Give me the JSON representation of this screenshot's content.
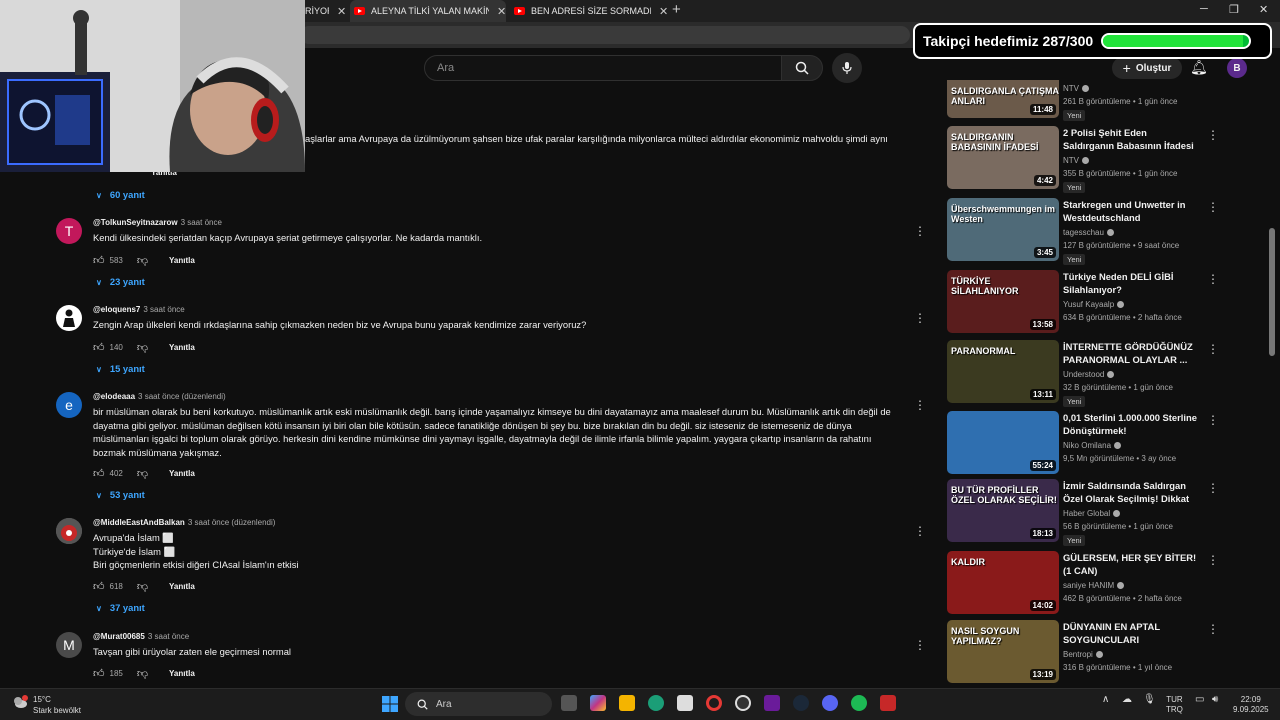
{
  "browser": {
    "tabs": [
      {
        "label": "RİYOR"
      },
      {
        "label": "ALEYNA TİLKİ YALAN MAKİNESİNE GİRDİ"
      },
      {
        "label": "BEN ADRESİ SİZE SORMADIM - A"
      }
    ]
  },
  "overlay": {
    "follower_goal_text": "Takipçi hedefimiz 287/300",
    "follower_progress": 0.957
  },
  "header": {
    "search_placeholder": "Ara",
    "create_label": "Oluştur",
    "avatar_letter": "B"
  },
  "comments": [
    {
      "text_partial": "aşlarlar ama Avrupaya da üzülmüyorum şahsen bize ufak paralar karşılığında milyonlarca mülteci aldırdılar ekonomimiz mahvoldu şimdi aynı",
      "reply_label": "Yanıtla",
      "replies": "60 yanıt"
    },
    {
      "user": "@TolkunSeyitnazarow",
      "time": "3 saat önce",
      "avatar": "T",
      "avatar_color": "#c2185b",
      "text": "Kendi ülkesindeki şeriatdan kaçıp Avrupaya şeriat getirmeye çalışıyorlar. Ne kadarda mantıklı.",
      "likes": "583",
      "reply_label": "Yanıtla",
      "replies": "23 yanıt"
    },
    {
      "user": "@eloquens7",
      "time": "3 saat önce",
      "avatar": "",
      "avatar_color": "#ffffff",
      "text": "Zengin Arap ülkeleri kendi ırkdaşlarına sahip çıkmazken neden biz ve Avrupa bunu yaparak kendimize zarar veriyoruz?",
      "likes": "140",
      "reply_label": "Yanıtla",
      "replies": "15 yanıt"
    },
    {
      "user": "@elodeaaa",
      "time": "3 saat önce (düzenlendi)",
      "avatar": "e",
      "avatar_color": "#1565c0",
      "text": "bir müslüman olarak bu beni korkutuyo. müslümanlık artık eski müslümanlık değil. barış içinde yaşamalıyız kimseye bu dini dayatamayız ama maalesef durum bu. Müslümanlık artık din değil de dayatma gibi geliyor. müslüman değilsen kötü insansın iyi biri olan bile kötüsün. sadece fanatikliğe dönüşen bi şey bu. bize bırakılan din bu değil. siz isteseniz de istemeseniz de dünya müslümanları işgalci bi toplum olarak görüyo. herkesin dini kendine mümkünse dini yaymayı işgalle, dayatmayla değil de ilimle irfanla bilimle yapalım. yaygara çıkartıp insanların da rahatını bozmak müslümana yakışmaz.",
      "likes": "402",
      "reply_label": "Yanıtla",
      "replies": "53 yanıt"
    },
    {
      "user": "@MiddleEastAndBalkan",
      "time": "3 saat önce (düzenlendi)",
      "avatar": "",
      "avatar_color": "#6a6a6a",
      "lines": [
        "Avrupa'da İslam ⬜",
        "Türkiye'de İslam ⬜",
        "Biri göçmenlerin etkisi diğeri CIAsal İslam'ın etkisi"
      ],
      "likes": "618",
      "reply_label": "Yanıtla",
      "replies": "37 yanıt"
    },
    {
      "user": "@Murat00685",
      "time": "3 saat önce",
      "avatar": "M",
      "avatar_color": "#4a4a4a",
      "text": "Tavşan gibi ürüyolar zaten ele geçirmesi normal",
      "likes": "185",
      "reply_label": "Yanıtla"
    }
  ],
  "sidebar": [
    {
      "thumb_text": "SALDIRGANLA ÇATIŞMA ANLARI",
      "duration": "11:48",
      "title": "",
      "channel": "NTV",
      "meta": "261 B görüntüleme • 1 gün önce",
      "badge": "Yeni",
      "bg": "#6b5a4a"
    },
    {
      "thumb_text": "SALDIRGANIN BABASININ İFADESİ",
      "duration": "4:42",
      "title": "2 Polisi Şehit Eden Saldırganın Babasının İfadesi Ortaya Çıktı, ...",
      "channel": "NTV",
      "meta": "355 B görüntüleme • 1 gün önce",
      "badge": "Yeni",
      "bg": "#7a6b60"
    },
    {
      "thumb_text": "Überschwemmungen im Westen",
      "duration": "3:45",
      "title": "Starkregen und Unwetter in Westdeutschland",
      "channel": "tagesschau",
      "meta": "127 B görüntüleme • 9 saat önce",
      "badge": "Yeni",
      "bg": "#4f6a78"
    },
    {
      "thumb_text": "TÜRKİYE SİLAHLANIYOR",
      "duration": "13:58",
      "title": "Türkiye Neden DELİ GİBİ Silahlanıyor?",
      "channel": "Yusuf Kayaalp",
      "meta": "634 B görüntüleme • 2 hafta önce",
      "badge": "",
      "bg": "#5a1d1d"
    },
    {
      "thumb_text": "PARANORMAL",
      "duration": "13:11",
      "title": "İNTERNETTE GÖRDÜĞÜNÜZ PARANORMAL OLAYLAR ...",
      "channel": "Understood",
      "meta": "32 B görüntüleme • 1 gün önce",
      "badge": "Yeni",
      "bg": "#3b3a20"
    },
    {
      "thumb_text": "",
      "duration": "55:24",
      "title": "0,01 Sterlini 1.000.000 Sterline Dönüştürmek!",
      "channel": "Niko Omilana",
      "meta": "9,5 Mn görüntüleme • 3 ay önce",
      "badge": "",
      "bg": "#2f6fb0"
    },
    {
      "thumb_text": "BU TÜR PROFİLLER ÖZEL OLARAK SEÇİLİR!",
      "duration": "18:13",
      "title": "İzmir Saldırısında Saldırgan Özel Olarak Seçilmiş! Dikkat ...",
      "channel": "Haber Global",
      "meta": "56 B görüntüleme • 1 gün önce",
      "badge": "Yeni",
      "bg": "#3a2a4a"
    },
    {
      "thumb_text": "KALDIR",
      "duration": "14:02",
      "title": "GÜLERSEM, HER ŞEY BİTER! (1 CAN)",
      "channel": "saniye HANIM",
      "meta": "462 B görüntüleme • 2 hafta önce",
      "badge": "",
      "bg": "#8a1a1a"
    },
    {
      "thumb_text": "NASIL SOYGUN YAPILMAZ?",
      "duration": "13:19",
      "title": "DÜNYANIN EN APTAL SOYGUNCULARI",
      "channel": "Bentropi",
      "meta": "316 B görüntüleme • 1 yıl önce",
      "badge": "",
      "bg": "#6b5a30"
    }
  ],
  "taskbar": {
    "temp": "15°C",
    "weather": "Stark bewölkt",
    "search": "Ara",
    "lang1": "TUR",
    "lang2": "TRQ",
    "time": "22:09",
    "date": "9.09.2025"
  }
}
